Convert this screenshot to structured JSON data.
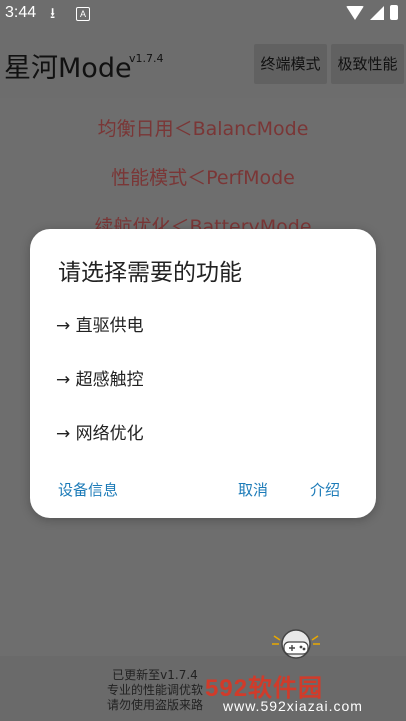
{
  "status_bar": {
    "time": "3:44",
    "download_icon": "download-icon",
    "a_label": "A",
    "wifi_icon": "wifi-icon",
    "signal_icon": "signal-icon",
    "battery_icon": "battery-icon"
  },
  "app": {
    "title": "星河Mode",
    "version": "v1.7.4",
    "button_terminal": "终端模式",
    "button_extreme": "极致性能"
  },
  "modes": [
    {
      "label": "均衡日用＜BalancMode"
    },
    {
      "label": "性能模式＜PerfMode"
    },
    {
      "label": "续航优化＜BatteryMode"
    }
  ],
  "dialog": {
    "title": "请选择需要的功能",
    "options": [
      {
        "label": "→ 直驱供电"
      },
      {
        "label": "→ 超感触控"
      },
      {
        "label": "→ 网络优化"
      }
    ],
    "device_info": "设备信息",
    "cancel": "取消",
    "intro": "介绍"
  },
  "footer": {
    "line1": "已更新至v1.7.4",
    "line2": "专业的性能调优软",
    "line3": "请勿使用盗版来路"
  },
  "watermark": {
    "brand": "592软件园",
    "url": "www.592xiazai.com"
  },
  "colors": {
    "overlay_bg": "#6e6e6e",
    "mode_text": "#7a3636",
    "dialog_button": "#1c7bb8",
    "watermark_red": "#d13b2a"
  }
}
